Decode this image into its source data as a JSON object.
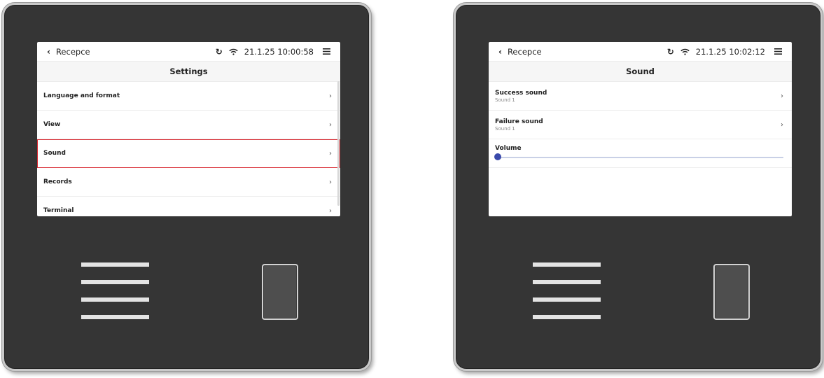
{
  "colors": {
    "device_body": "#353535",
    "selection_outline": "#d7262e",
    "slider_thumb": "#3949ab",
    "slider_track": "#c9d0e6"
  },
  "left_screen": {
    "status": {
      "back_label": "Recepce",
      "time": "21.1.25 10:00:58",
      "refresh_icon": "refresh-icon",
      "wifi_icon": "wifi-icon",
      "menu_icon": "hamburger-icon"
    },
    "title": "Settings",
    "items": [
      {
        "label": "Language and format"
      },
      {
        "label": "View"
      },
      {
        "label": "Sound",
        "selected": true
      },
      {
        "label": "Records"
      },
      {
        "label": "Terminal"
      }
    ]
  },
  "right_screen": {
    "status": {
      "back_label": "Recepce",
      "time": "21.1.25 10:02:12",
      "refresh_icon": "refresh-icon",
      "wifi_icon": "wifi-icon",
      "menu_icon": "hamburger-icon"
    },
    "title": "Sound",
    "items": [
      {
        "label": "Success sound",
        "value": "Sound 1"
      },
      {
        "label": "Failure sound",
        "value": "Sound 1"
      }
    ],
    "volume": {
      "label": "Volume",
      "level": 0
    }
  }
}
